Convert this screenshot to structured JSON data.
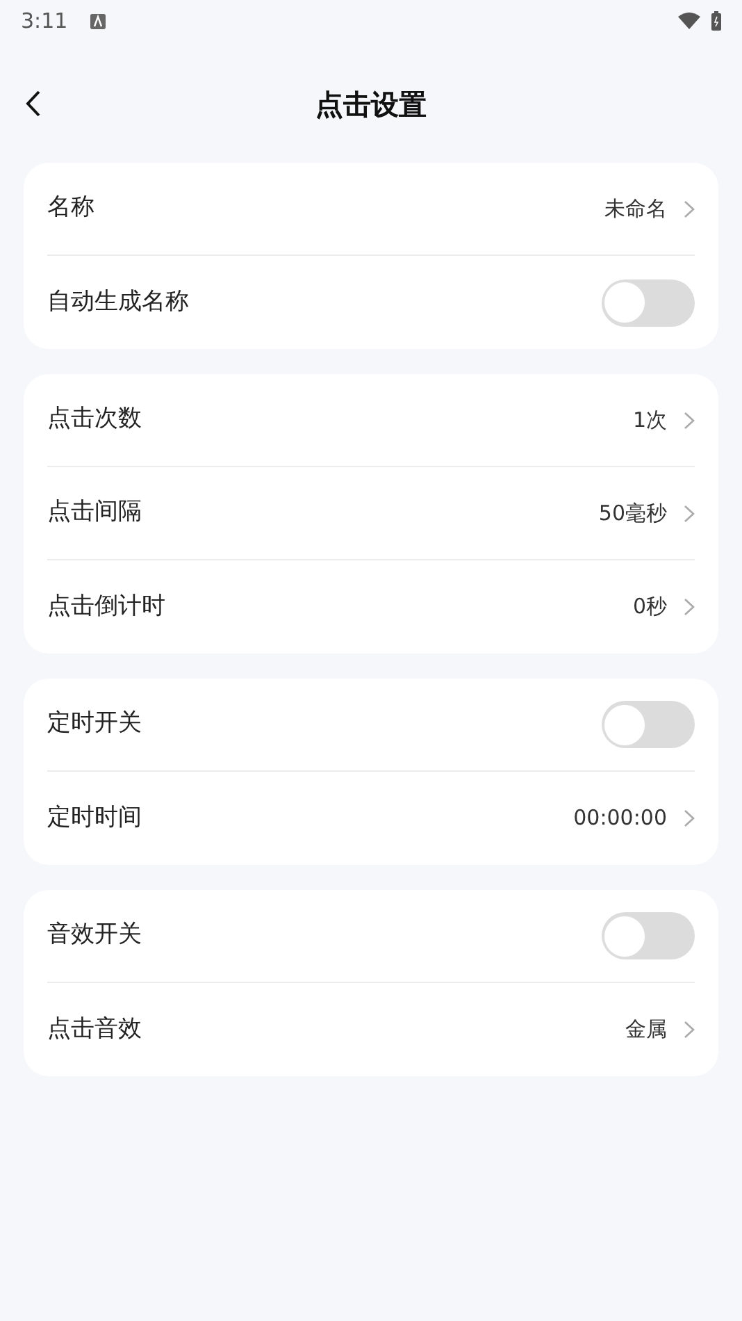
{
  "status_bar": {
    "time": "3:11"
  },
  "header": {
    "title": "点击设置"
  },
  "groups": [
    {
      "rows": [
        {
          "kind": "link",
          "label": "名称",
          "value": "未命名"
        },
        {
          "kind": "toggle",
          "label": "自动生成名称",
          "on": false
        }
      ]
    },
    {
      "rows": [
        {
          "kind": "link",
          "label": "点击次数",
          "value": "1次"
        },
        {
          "kind": "link",
          "label": "点击间隔",
          "value": "50毫秒"
        },
        {
          "kind": "link",
          "label": "点击倒计时",
          "value": "0秒"
        }
      ]
    },
    {
      "rows": [
        {
          "kind": "toggle",
          "label": "定时开关",
          "on": false
        },
        {
          "kind": "link",
          "label": "定时时间",
          "value": "00:00:00"
        }
      ]
    },
    {
      "rows": [
        {
          "kind": "toggle",
          "label": "音效开关",
          "on": false
        },
        {
          "kind": "link",
          "label": "点击音效",
          "value": "金属"
        }
      ]
    }
  ]
}
